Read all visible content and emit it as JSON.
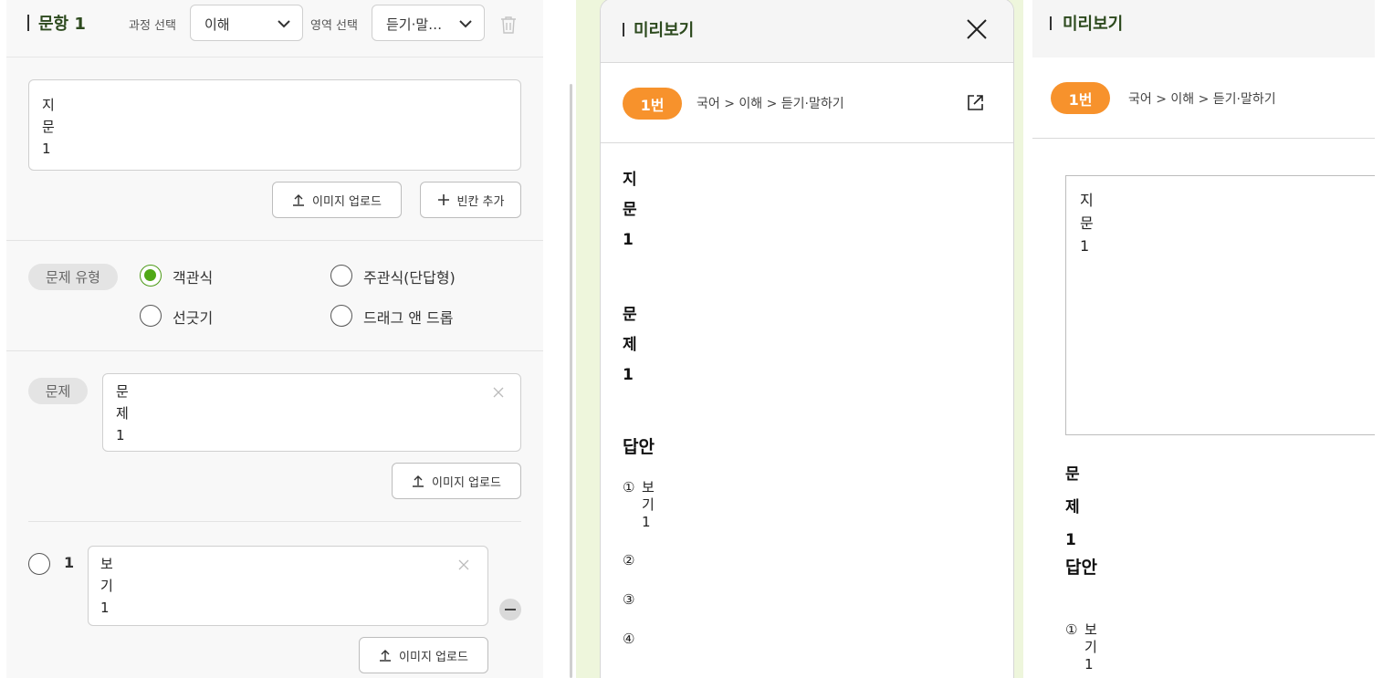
{
  "editor": {
    "header": {
      "title": "문항 1",
      "course_label": "과정 선택",
      "course_value": "이해",
      "area_label": "영역 선택",
      "area_value": "듣기·말…"
    },
    "passage": {
      "lines": [
        "지",
        "문",
        "1"
      ],
      "upload_label": "이미지 업로드",
      "add_blank_label": "빈칸 추가"
    },
    "question_type": {
      "label": "문제 유형",
      "options": [
        {
          "label": "객관식",
          "selected": true
        },
        {
          "label": "주관식(단답형)",
          "selected": false
        },
        {
          "label": "선긋기",
          "selected": false
        },
        {
          "label": "드래그 앤 드롭",
          "selected": false
        }
      ]
    },
    "question": {
      "label": "문제",
      "lines": [
        "문",
        "제",
        "1"
      ],
      "upload_label": "이미지 업로드"
    },
    "choice1": {
      "number": "1",
      "lines": [
        "보",
        "기",
        "1"
      ],
      "upload_label": "이미지 업로드"
    }
  },
  "preview": {
    "title": "미리보기",
    "badge": "1번",
    "breadcrumb": "국어 > 이해 > 듣기·말하기",
    "passage_lines": [
      "지",
      "문",
      "1"
    ],
    "question_lines": [
      "문",
      "제",
      "1"
    ],
    "answer_title": "답안",
    "options": [
      {
        "marker": "①",
        "lines": [
          "보",
          "기",
          "1"
        ]
      },
      {
        "marker": "②",
        "lines": []
      },
      {
        "marker": "③",
        "lines": []
      },
      {
        "marker": "④",
        "lines": []
      }
    ]
  },
  "preview_right": {
    "title": "미리보기",
    "badge": "1번",
    "breadcrumb": "국어 > 이해 > 듣기·말하기",
    "passage_lines": [
      "지",
      "문",
      "1"
    ],
    "question_lines": [
      "문",
      "제",
      "1"
    ],
    "answer_title": "답안",
    "option1_marker": "①",
    "option1_lines": [
      "보",
      "기",
      "1"
    ]
  },
  "colors": {
    "accent_green": "#4fa816",
    "badge_orange": "#f7922c",
    "title_green": "#2d4a1e",
    "preview_backdrop": "#eef6dc"
  }
}
